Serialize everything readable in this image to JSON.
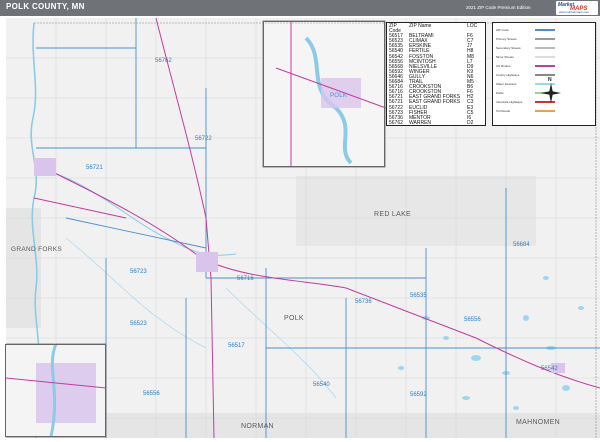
{
  "header": {
    "title": "POLK COUNTY, MN",
    "edition": "2021 ZIP Code Premium Edition",
    "logo": {
      "line1": "Market",
      "line2": "MAPS",
      "line3": "www.marketmaps.com"
    }
  },
  "colors": {
    "land": "#f1f1f1",
    "water": "#9fd6ef",
    "city": "#d9c4ec",
    "zip_boundary": "#4a8fd1",
    "highway": "#c23d9e",
    "road": "#999999",
    "state_line": "#444444",
    "zip_label": "#2c7fc4"
  },
  "zip_table": {
    "headers": [
      "ZIP Code",
      "ZIP Name",
      "LOC"
    ],
    "rows": [
      [
        "56517",
        "BELTRAMI",
        "F6"
      ],
      [
        "56523",
        "CLIMAX",
        "C7"
      ],
      [
        "56535",
        "ERSKINE",
        "J7"
      ],
      [
        "56540",
        "FERTILE",
        "H8"
      ],
      [
        "56542",
        "FOSSTON",
        "M8"
      ],
      [
        "56556",
        "MCINTOSH",
        "L7"
      ],
      [
        "56568",
        "NIELSVILLE",
        "D9"
      ],
      [
        "56592",
        "WINGER",
        "K9"
      ],
      [
        "56646",
        "GULLY",
        "N6"
      ],
      [
        "56684",
        "TRAIL",
        "M5"
      ],
      [
        "56716",
        "CROOKSTON",
        "B6"
      ],
      [
        "56716",
        "CROOKSTON",
        "F6"
      ],
      [
        "56721",
        "EAST GRAND FORKS",
        "H2"
      ],
      [
        "56721",
        "EAST GRAND FORKS",
        "C3"
      ],
      [
        "56722",
        "EUCLID",
        "E3"
      ],
      [
        "56723",
        "FISHER",
        "C5"
      ],
      [
        "56736",
        "MENTOR",
        "I6"
      ],
      [
        "56762",
        "WARREN",
        "D2"
      ]
    ]
  },
  "legend": [
    {
      "label": "ZIP Code",
      "color": "#4a8fd1"
    },
    {
      "label": "Primary Streets",
      "color": "#999999"
    },
    {
      "label": "Secondary Streets",
      "color": "#bbbbbb"
    },
    {
      "label": "Minor Streets",
      "color": "#dddddd"
    },
    {
      "label": "US Routes",
      "color": "#c23d9e"
    },
    {
      "label": "County Highways",
      "color": "#888888"
    },
    {
      "label": "Water Features",
      "color": "#9fd6ef"
    },
    {
      "label": "Parks",
      "color": "#9ad09a"
    },
    {
      "label": "Interstate Highways",
      "color": "#d6322a"
    },
    {
      "label": "Toll Roads",
      "color": "#f0a040"
    }
  ],
  "zip_labels": [
    "56762",
    "56722",
    "56721",
    "56723",
    "56716",
    "56523",
    "56517",
    "56556",
    "56540",
    "56736",
    "56535",
    "56556",
    "56684",
    "56592",
    "56542"
  ],
  "regions": [
    "RED LAKE",
    "GRAND FORKS",
    "POLK",
    "NORMAN",
    "MAHNOMEN"
  ],
  "inset_label": "POLK",
  "compass": {
    "north": "N"
  }
}
